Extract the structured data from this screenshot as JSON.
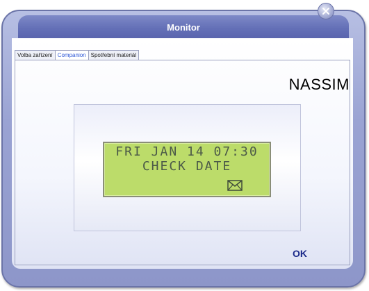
{
  "window": {
    "title": "Monitor",
    "close_icon": "close-icon"
  },
  "tabs": [
    {
      "label": "Volba zařízení",
      "active": false
    },
    {
      "label": "Companion",
      "active": true
    },
    {
      "label": "Spotřební materiál",
      "active": false
    }
  ],
  "device": {
    "name": "NASSIM"
  },
  "lcd": {
    "line1": "FRI JAN 14 07:30",
    "line2": "CHECK DATE",
    "message_icon": "envelope-icon"
  },
  "buttons": {
    "ok_label": "OK"
  },
  "colors": {
    "title_bar": "#6470b7",
    "lcd_background": "#bcdc6a",
    "lcd_text": "#4c5a48",
    "active_tab_text": "#2a55d6",
    "ok_text": "#1b2a8a"
  }
}
